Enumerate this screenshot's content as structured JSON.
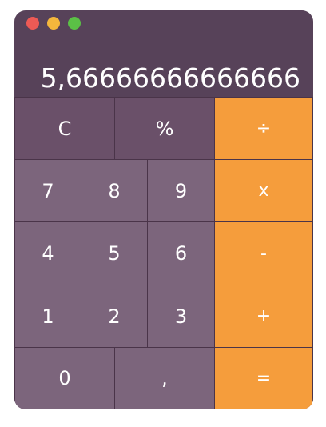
{
  "display": {
    "value": "5,66666666666666"
  },
  "keys": {
    "clear": "C",
    "percent": "%",
    "divide": "÷",
    "seven": "7",
    "eight": "8",
    "nine": "9",
    "multiply": "x",
    "four": "4",
    "five": "5",
    "six": "6",
    "subtract": "-",
    "one": "1",
    "two": "2",
    "three": "3",
    "add": "+",
    "zero": "0",
    "decimal": ",",
    "equals": "="
  }
}
